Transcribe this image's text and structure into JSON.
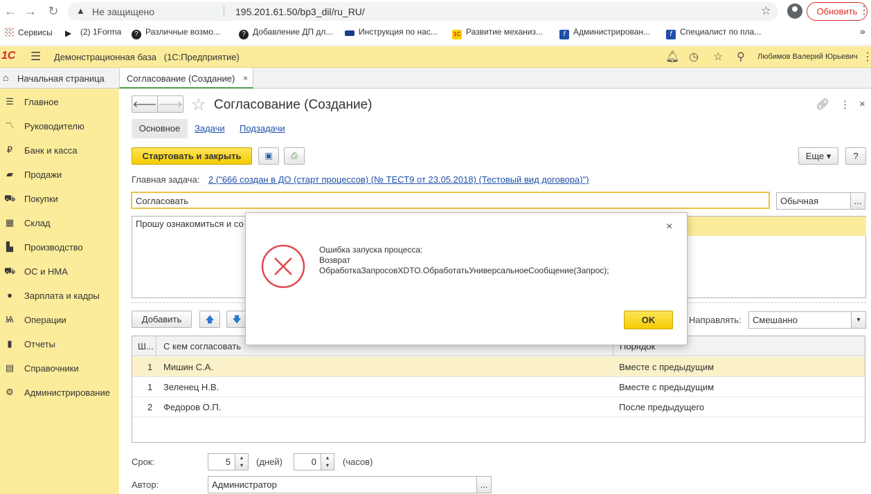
{
  "browser": {
    "insecure_label": "Не защищено",
    "url": "195.201.61.50/bp3_dil/ru_RU/",
    "update_button": "Обновить",
    "bookmarks": [
      {
        "label": "Сервисы",
        "icon": "apps-grid-icon"
      },
      {
        "label": "(2) 1Forma",
        "icon": "play-icon"
      },
      {
        "label": "Различные возмо...",
        "icon": "help-circle-icon"
      },
      {
        "label": "Добавление ДП дл...",
        "icon": "help-circle-icon"
      },
      {
        "label": "Инструкция по нас...",
        "icon": "bookmark-icon"
      },
      {
        "label": "Развитие механиз...",
        "icon": "1c-icon"
      },
      {
        "label": "Администрирован...",
        "icon": "doc-f-icon"
      },
      {
        "label": "Специалист по пла...",
        "icon": "doc-f-icon"
      }
    ],
    "more_bookmarks": "»"
  },
  "header": {
    "logo": "1С",
    "base_name": "Демонстрационная база",
    "platform": "(1С:Предприятие)",
    "user": "Любимов Валерий Юрьевич"
  },
  "tabs": {
    "home": "Начальная страница",
    "doc": "Согласование (Создание)",
    "close": "×"
  },
  "sidebar": {
    "items": [
      {
        "label": "Главное",
        "icon": "menu-lines-icon"
      },
      {
        "label": "Руководителю",
        "icon": "trend-icon"
      },
      {
        "label": "Банк и касса",
        "icon": "ruble-icon"
      },
      {
        "label": "Продажи",
        "icon": "bag-icon"
      },
      {
        "label": "Покупки",
        "icon": "cart-icon"
      },
      {
        "label": "Склад",
        "icon": "warehouse-icon"
      },
      {
        "label": "Производство",
        "icon": "factory-icon"
      },
      {
        "label": "ОС и НМА",
        "icon": "truck-icon"
      },
      {
        "label": "Зарплата и кадры",
        "icon": "person-icon"
      },
      {
        "label": "Операции",
        "icon": "operations-icon"
      },
      {
        "label": "Отчеты",
        "icon": "bar-chart-icon"
      },
      {
        "label": "Справочники",
        "icon": "book-icon"
      },
      {
        "label": "Администрирование",
        "icon": "gear-icon"
      }
    ]
  },
  "form": {
    "title": "Согласование (Создание)",
    "subtabs": [
      "Основное",
      "Задачи",
      "Подзадачи"
    ],
    "start_button": "Стартовать и закрыть",
    "more_button": "Еще",
    "help_button": "?",
    "main_task_label": "Главная задача:",
    "main_task_link": "2 (\"666 создан в ДО (старт процессов) (№ ТЕСТ9 от 23.05.2018) (Тестовый вид договора)\")",
    "subject_value": "Согласовать",
    "importance_value": "Обычная",
    "description_value": "Прошу ознакомиться и со",
    "add_button": "Добавить",
    "route_label": "Направлять:",
    "route_value": "Смешанно",
    "table": {
      "headers": [
        "Ш...",
        "С кем согласовать",
        "Порядок"
      ],
      "rows": [
        {
          "step": "1",
          "who": "Мишин С.А.",
          "order": "Вместе с предыдущим"
        },
        {
          "step": "1",
          "who": "Зеленец Н.В.",
          "order": "Вместе с предыдущим"
        },
        {
          "step": "2",
          "who": "Федоров О.П.",
          "order": "После предыдущего"
        }
      ]
    },
    "term_label": "Срок:",
    "days_value": "5",
    "days_label": "(дней)",
    "hours_value": "0",
    "hours_label": "(часов)",
    "author_label": "Автор:",
    "author_value": "Администратор",
    "ellipsis": "..."
  },
  "dialog": {
    "line1": "Ошибка запуска процесса:",
    "line2": "Возврат",
    "line3": "ОбработкаЗапросовXDTO.ОбработатьУниверсальноеСообщение(Запрос);",
    "ok_button": "OK",
    "close": "×"
  },
  "colors": {
    "accent_yellow": "#fbec9b",
    "button_yellow": "#f4cc00",
    "error_red": "#e0484e",
    "link_blue": "#1f4fa8"
  }
}
